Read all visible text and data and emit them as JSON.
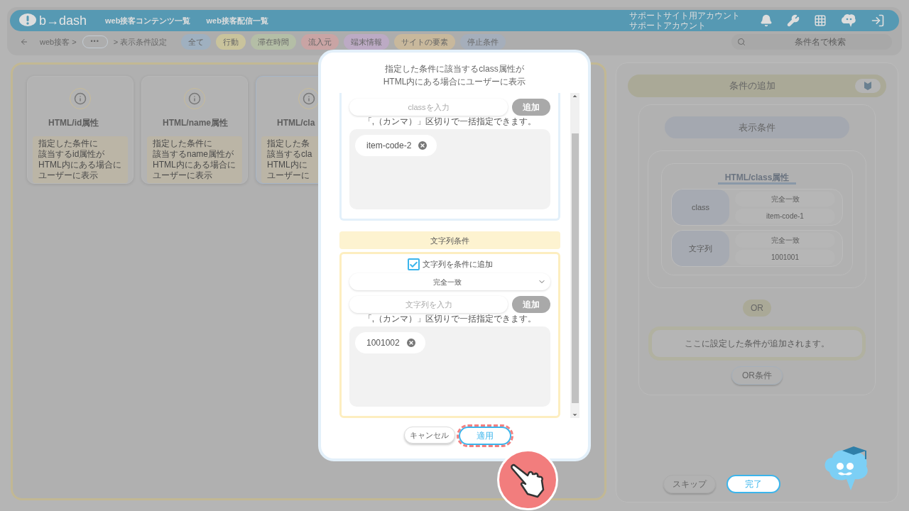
{
  "header": {
    "logo": "b→dash",
    "nav": [
      "web接客コンテンツ一覧",
      "web接客配信一覧"
    ],
    "account": [
      "サポートサイト用アカウント",
      "サポートアカウント"
    ]
  },
  "breadcrumb": {
    "items": [
      "web接客 >",
      "•••",
      "> 表示条件設定"
    ]
  },
  "filters": [
    {
      "label": "全て",
      "color": "#9fb0c0"
    },
    {
      "label": "行動",
      "color": "#c9c39c"
    },
    {
      "label": "滞在時間",
      "color": "#b4bea6"
    },
    {
      "label": "流入元",
      "color": "#c9a4a4"
    },
    {
      "label": "端末情報",
      "color": "#bcaac4"
    },
    {
      "label": "サイトの要素",
      "color": "#c8b89c"
    },
    {
      "label": "停止条件",
      "color": "#a5aebb"
    }
  ],
  "search": {
    "placeholder": "条件名で検索"
  },
  "cards": [
    {
      "title": "HTML/id属性",
      "description": [
        "指定した条件に",
        "該当するid属性が",
        "HTML内にある場合に",
        "ユーザーに表示"
      ],
      "selected": false
    },
    {
      "title": "HTML/name属性",
      "description": [
        "指定した条件に",
        "該当するname属性が",
        "HTML内にある場合に",
        "ユーザーに表示"
      ],
      "selected": false
    },
    {
      "title": "HTML/cla",
      "description": [
        "指定した条",
        "該当するcla",
        "HTML内に",
        "ユーザーに"
      ],
      "selected": true
    }
  ],
  "modal": {
    "description": "指定した条件に該当するclass属性が\nHTML内にある場合にユーザーに表示",
    "class_section": {
      "placeholder": "classを入力",
      "add_button": {
        "label": "追加",
        "disabled": true
      },
      "hint": "「,（カンマ）」区切りで一括指定できます。",
      "tags": [
        "item-code-2"
      ]
    },
    "string_section": {
      "title": "文字列条件",
      "checkbox": {
        "label": "文字列を条件に追加",
        "checked": true
      },
      "select": "完全一致",
      "placeholder": "文字列を入力",
      "add_button": {
        "label": "追加",
        "disabled": true
      },
      "hint": "「,（カンマ）」区切りで一括指定できます。",
      "tags": [
        "1001002"
      ]
    },
    "buttons": {
      "cancel": "キャンセル",
      "apply": "適用"
    }
  },
  "right_panel": {
    "title": "条件の追加",
    "display_conditions": "表示条件",
    "condition": {
      "title": "HTML/class属性",
      "rows": [
        {
          "label": "class",
          "match": "完全一致",
          "value": "item-code-1"
        },
        {
          "label": "文字列",
          "match": "完全一致",
          "value": "1001001"
        }
      ]
    },
    "or_label": "OR",
    "placeholder": "ここに設定した条件が追加されます。",
    "or_button": "OR条件",
    "skip": "スキップ",
    "done": "完了"
  }
}
